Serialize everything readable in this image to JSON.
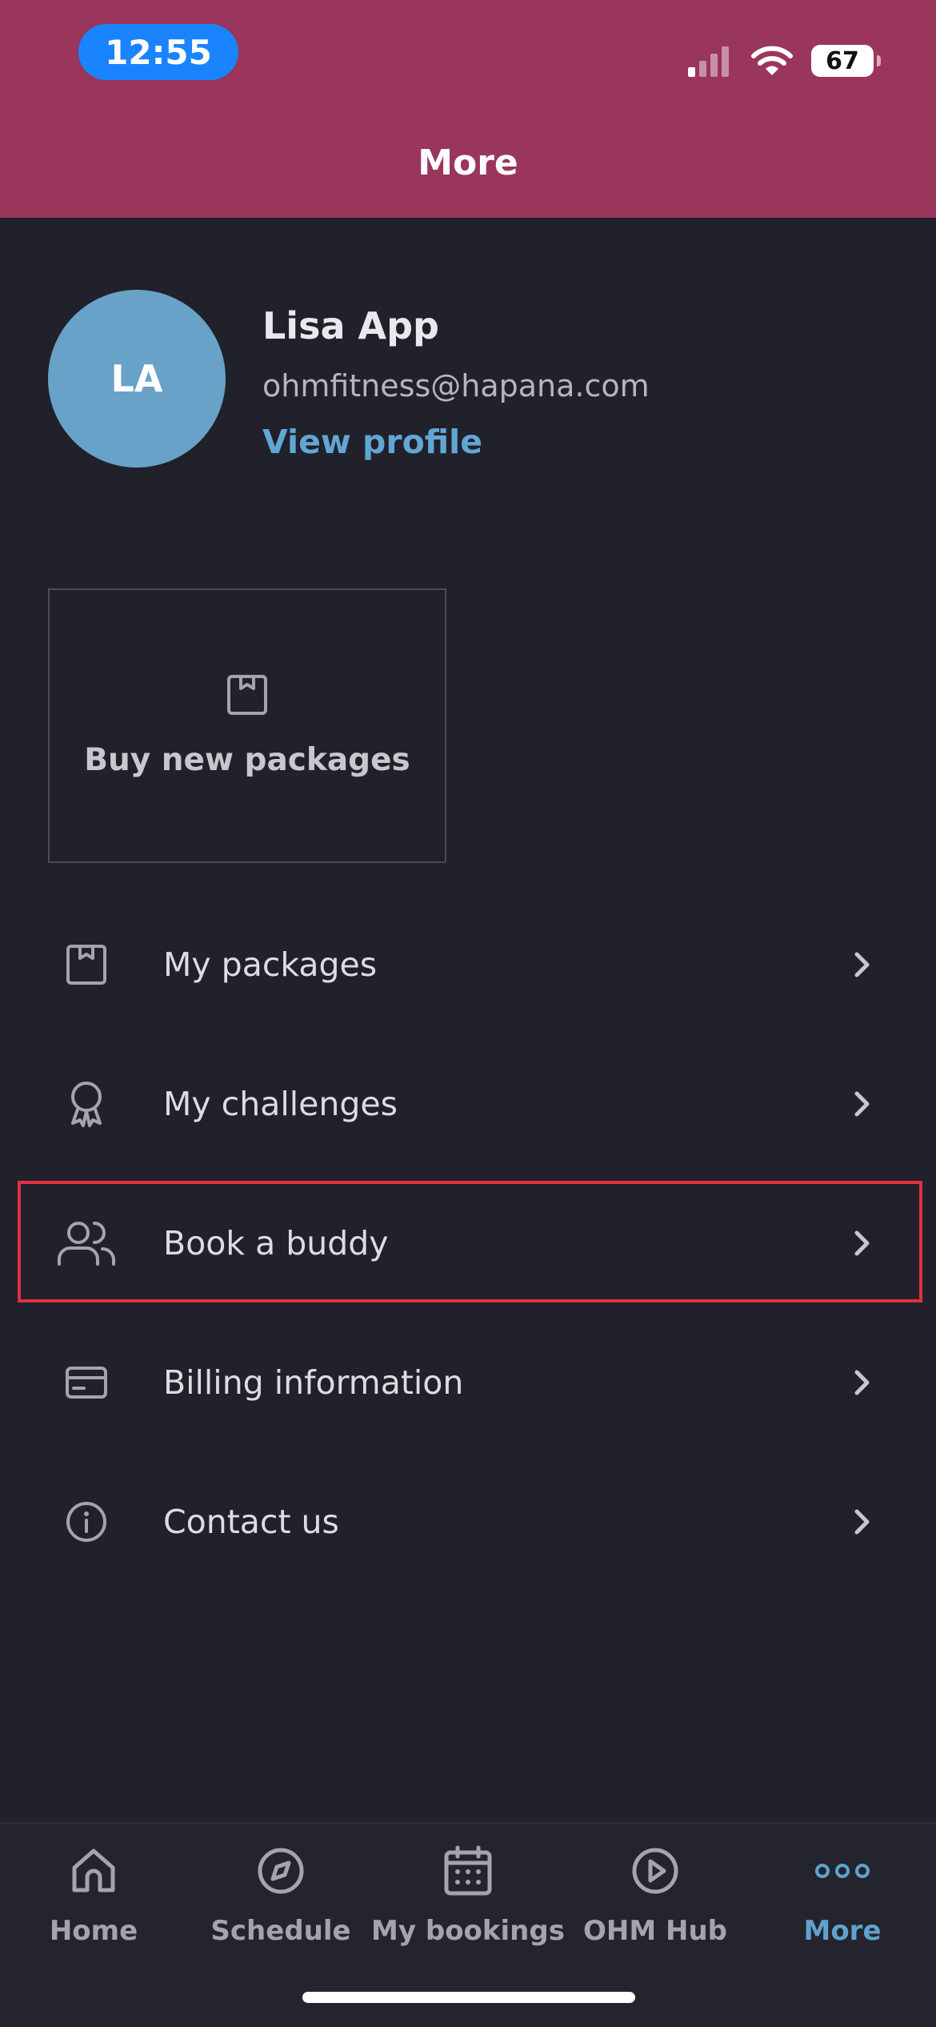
{
  "status_bar": {
    "time": "12:55",
    "battery": "67"
  },
  "header": {
    "title": "More"
  },
  "profile": {
    "initials": "LA",
    "name": "Lisa App",
    "email": "ohmfitness@hapana.com",
    "view_profile": "View profile"
  },
  "card": {
    "label": "Buy new packages",
    "icon": "package-icon"
  },
  "menu": [
    {
      "label": "My packages",
      "icon": "package-icon"
    },
    {
      "label": "My challenges",
      "icon": "award-icon"
    },
    {
      "label": "Book a buddy",
      "icon": "users-icon",
      "highlighted": true
    },
    {
      "label": "Billing information",
      "icon": "credit-card-icon"
    },
    {
      "label": "Contact us",
      "icon": "info-icon"
    }
  ],
  "tabs": [
    {
      "label": "Home",
      "icon": "home-icon"
    },
    {
      "label": "Schedule",
      "icon": "compass-icon"
    },
    {
      "label": "My bookings",
      "icon": "calendar-icon"
    },
    {
      "label": "OHM Hub",
      "icon": "play-circle-icon"
    },
    {
      "label": "More",
      "icon": "more-dots-icon",
      "active": true
    }
  ],
  "colors": {
    "header_bg": "#9a355c",
    "screen_bg": "#20212a",
    "accent": "#5fa2d0",
    "avatar_bg": "#68a2c8",
    "highlight_border": "#e33040"
  }
}
